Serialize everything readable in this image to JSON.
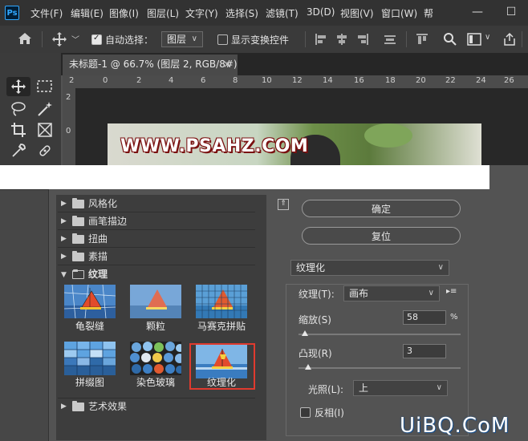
{
  "app": {
    "logo": "Ps"
  },
  "menubar": {
    "items": [
      "文件(F)",
      "编辑(E)",
      "图像(I)",
      "图层(L)",
      "文字(Y)",
      "选择(S)",
      "滤镜(T)",
      "3D(D)",
      "视图(V)",
      "窗口(W)",
      "帮"
    ],
    "window_buttons": {
      "minimize": "—",
      "maximize": "☐"
    }
  },
  "options_bar": {
    "auto_select_label": "自动选择：",
    "auto_select_checked": true,
    "auto_select_target": "图层",
    "show_transform_label": "显示变换控件",
    "show_transform_checked": false
  },
  "panel_collapse": "«",
  "document_tab": {
    "title": "未标题-1 @ 66.7% (图层 2, RGB/8#) *",
    "close": "×"
  },
  "ruler": {
    "horizontal_ticks": [
      "2",
      "0",
      "2",
      "4",
      "6",
      "8",
      "10",
      "12",
      "14",
      "16",
      "18",
      "20",
      "22",
      "24",
      "26"
    ],
    "vertical_ticks": [
      "2",
      "0"
    ]
  },
  "canvas": {
    "image_text": "WWW.PSAHZ.COM"
  },
  "filter_gallery": {
    "collapse_icon": "⇑",
    "categories_top": [
      {
        "label": "风格化",
        "expanded": false
      },
      {
        "label": "画笔描边",
        "expanded": false
      },
      {
        "label": "扭曲",
        "expanded": false
      },
      {
        "label": "素描",
        "expanded": false
      },
      {
        "label": "纹理",
        "expanded": true
      }
    ],
    "texture_filters": [
      {
        "label": "龟裂缝"
      },
      {
        "label": "颗粒"
      },
      {
        "label": "马赛克拼贴"
      },
      {
        "label": "拼缀图"
      },
      {
        "label": "染色玻璃"
      },
      {
        "label": "纹理化",
        "selected": true
      }
    ],
    "categories_bottom": [
      {
        "label": "艺术效果",
        "expanded": false
      }
    ],
    "ok_button": "确定",
    "reset_button": "复位",
    "filter_select": "纹理化",
    "settings": {
      "texture_label": "纹理(T):",
      "texture_value": "画布",
      "menu_icon": "▸≡",
      "scaling_label": "缩放(S)",
      "scaling_value": "58",
      "scaling_unit": "%",
      "scaling_fraction": 0.04,
      "relief_label": "凸现(R)",
      "relief_value": "3",
      "relief_fraction": 0.06,
      "light_label": "光照(L):",
      "light_value": "上",
      "invert_label": "反相(I)",
      "invert_checked": false
    }
  },
  "site_watermark": "UiBQ.CoM",
  "colors": {
    "selection_frame": "#e03a2e",
    "panel_bg": "#535353",
    "list_bg": "#3d3d3d"
  }
}
